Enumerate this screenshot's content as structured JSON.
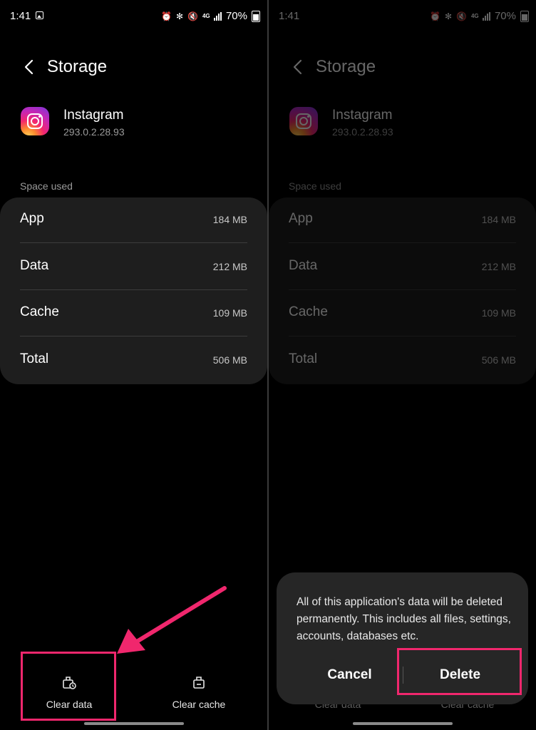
{
  "status_bar": {
    "time": "1:41",
    "network": "4G",
    "battery": "70%"
  },
  "header": {
    "title": "Storage"
  },
  "app": {
    "name": "Instagram",
    "version": "293.0.2.28.93"
  },
  "storage": {
    "section_label": "Space used",
    "rows": [
      {
        "label": "App",
        "value": "184 MB"
      },
      {
        "label": "Data",
        "value": "212 MB"
      },
      {
        "label": "Cache",
        "value": "109 MB"
      },
      {
        "label": "Total",
        "value": "506 MB"
      }
    ]
  },
  "actions": {
    "clear_data": "Clear data",
    "clear_cache": "Clear cache"
  },
  "dialog": {
    "message": "All of this application's data will be deleted permanently. This includes all files, settings, accounts, databases etc.",
    "cancel": "Cancel",
    "delete": "Delete"
  },
  "colors": {
    "highlight": "#f0276d",
    "card": "#1e1e1e",
    "dialog": "#262626"
  },
  "icons": [
    "back-icon",
    "app-icon-instagram",
    "clear-data-icon",
    "clear-cache-icon",
    "gallery-icon",
    "bluetooth-icon",
    "mute-icon",
    "signal-icon",
    "battery-icon"
  ]
}
